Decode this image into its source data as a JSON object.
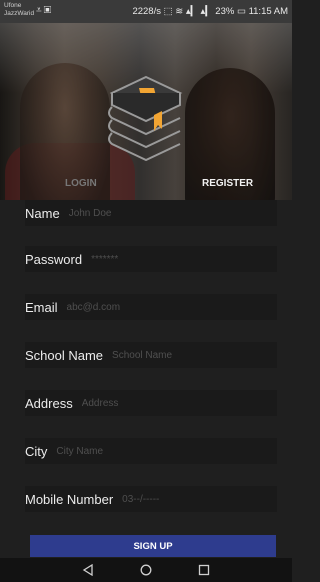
{
  "status_bar": {
    "carrier_line1": "Ufone",
    "carrier_line2": "JazzWarid",
    "network_speed": "2228/s",
    "battery": "23%",
    "time": "11:15 AM"
  },
  "tabs": {
    "login": "LOGIN",
    "register": "REGISTER"
  },
  "form": {
    "fields": [
      {
        "label": "Name",
        "placeholder": "John Doe"
      },
      {
        "label": "Password",
        "placeholder": "*******"
      },
      {
        "label": "Email",
        "placeholder": "abc@d.com"
      },
      {
        "label": "School Name",
        "placeholder": "School Name"
      },
      {
        "label": "Address",
        "placeholder": "Address"
      },
      {
        "label": "City",
        "placeholder": "City Name"
      },
      {
        "label": "Mobile Number",
        "placeholder": "03--/-----"
      }
    ]
  },
  "signup_label": "SIGN UP",
  "colors": {
    "background": "#1f1f1f",
    "signup_button": "#2e3c8e",
    "logo_accent": "#f2a533"
  },
  "icons": [
    "books-logo-icon",
    "back-nav-icon",
    "home-nav-icon",
    "recents-nav-icon"
  ]
}
